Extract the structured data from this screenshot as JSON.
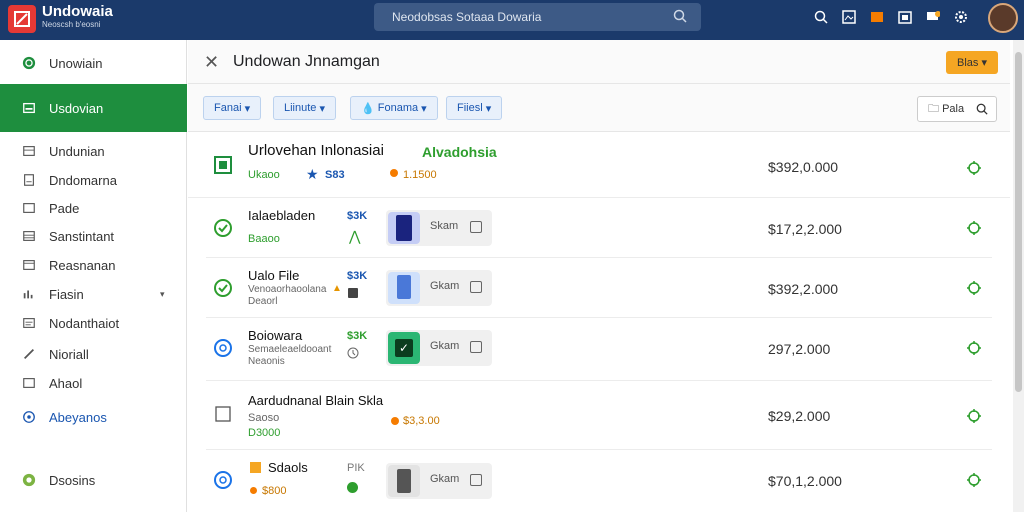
{
  "app": {
    "title": "Undowaia",
    "subtitle": "Neoscsh b'eosni"
  },
  "search": {
    "placeholder": "Neodobsas Sotaaa Dowaria"
  },
  "sidebar": {
    "items": [
      {
        "label": "Unowiain"
      },
      {
        "label": "Usdovian"
      },
      {
        "label": "Undunian"
      },
      {
        "label": "Dndomarna"
      },
      {
        "label": "Pade"
      },
      {
        "label": "Sanstintant"
      },
      {
        "label": "Reasnanan"
      },
      {
        "label": "Fiasin"
      },
      {
        "label": "Nodanthaiot"
      },
      {
        "label": "Nioriall"
      },
      {
        "label": "Ahaol"
      },
      {
        "label": "Abeyanos"
      },
      {
        "label": "Dsosins"
      }
    ]
  },
  "header": {
    "title": "Undowan Jnnamgan",
    "button": "Blas"
  },
  "filters": {
    "chips": [
      "Fanai",
      "Liinute",
      "Fonama",
      "Fiiesl"
    ],
    "search": "Pala"
  },
  "rows": [
    {
      "title": "Urlovehan Inlonasiai",
      "title_green": "Alvadohsia",
      "sub": "Ukaoo",
      "blue": "S83",
      "orange": "1.1500",
      "price": "$392,0.000"
    },
    {
      "title": "Ialaebladen",
      "sub": "Baaoo",
      "blue": "$3K",
      "thumb": "Skam",
      "price": "$17,2,2.000"
    },
    {
      "title": "Ualo File",
      "sub": "Venoaorhaoolana",
      "sub2": "Deaorl",
      "blue": "$3K",
      "thumb": "Gkam",
      "price": "$392,2.000"
    },
    {
      "title": "Boiowara",
      "sub": "Semaeleaeldooant",
      "sub2": "Neaonis",
      "blue": "$3K",
      "thumb": "Gkam",
      "price": "297,2.000"
    },
    {
      "title": "Aardudnanal Blain Skla",
      "sub": "Saoso",
      "green": "D3000",
      "orange": "$3,3.00",
      "price": "$29,2.000"
    },
    {
      "title": "Sdaols",
      "orange_sub": "$800",
      "blue": "PIK",
      "thumb": "Gkam",
      "price": "$70,1,2.000"
    }
  ],
  "colors": {
    "accent": "#1e8e3e",
    "topbar": "#1b3a6b",
    "button": "#f5a623"
  }
}
